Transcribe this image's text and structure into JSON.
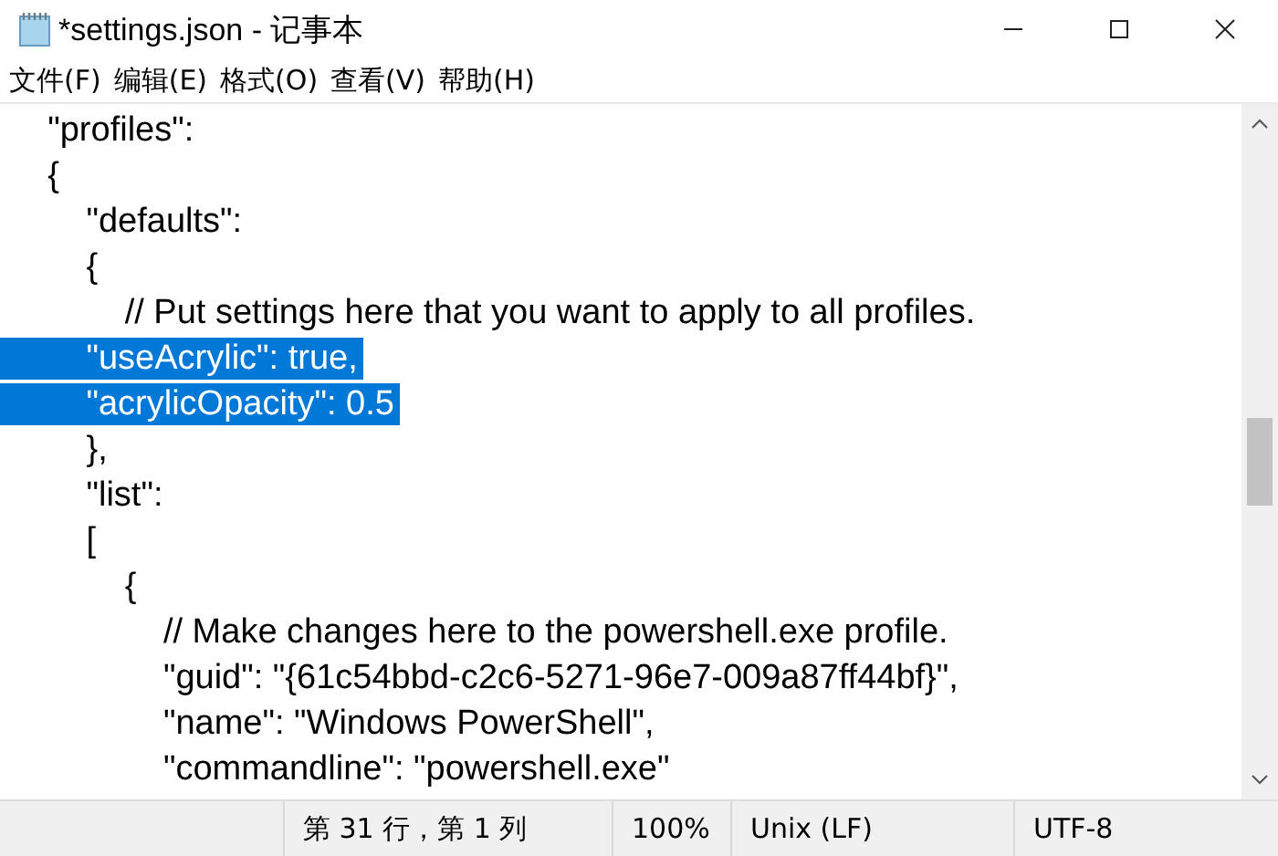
{
  "window": {
    "title": "*settings.json - 记事本"
  },
  "menu": [
    {
      "label": "文件(F)"
    },
    {
      "label": "编辑(E)"
    },
    {
      "label": "格式(O)"
    },
    {
      "label": "查看(V)"
    },
    {
      "label": "帮助(H)"
    }
  ],
  "editor": {
    "lines": [
      {
        "text": "    \"profiles\":",
        "selected": false
      },
      {
        "text": "    {",
        "selected": false
      },
      {
        "text": "        \"defaults\":",
        "selected": false
      },
      {
        "text": "        {",
        "selected": false
      },
      {
        "text": "            // Put settings here that you want to apply to all profiles.",
        "selected": false
      },
      {
        "text": "        \"useAcrylic\": true,",
        "selected": true
      },
      {
        "text": "        \"acrylicOpacity\": 0.5",
        "selected": true
      },
      {
        "text": "        },",
        "selected": false
      },
      {
        "text": "        \"list\":",
        "selected": false
      },
      {
        "text": "        [",
        "selected": false
      },
      {
        "text": "            {",
        "selected": false
      },
      {
        "text": "                // Make changes here to the powershell.exe profile.",
        "selected": false
      },
      {
        "text": "                \"guid\": \"{61c54bbd-c2c6-5271-96e7-009a87ff44bf}\",",
        "selected": false
      },
      {
        "text": "                \"name\": \"Windows PowerShell\",",
        "selected": false
      },
      {
        "text": "                \"commandline\": \"powershell.exe\"",
        "selected": false
      }
    ]
  },
  "status_bar": [
    "第 31 行，第 1 列",
    "100%",
    "Unix (LF)",
    "UTF-8"
  ]
}
